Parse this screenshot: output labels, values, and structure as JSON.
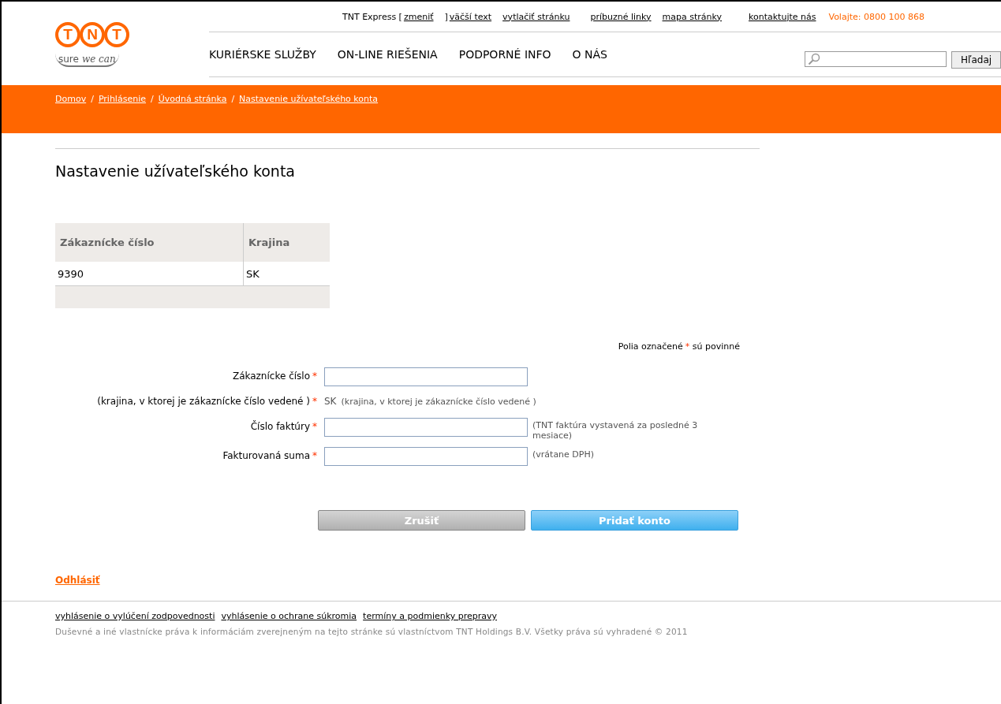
{
  "logo": {
    "letters": [
      "T",
      "N",
      "T"
    ],
    "tagline_plain": "sure",
    "tagline_script": "we can"
  },
  "top_links": [
    {
      "kind": "text",
      "text": "TNT Express ["
    },
    {
      "kind": "link",
      "text": "zmeniť"
    },
    {
      "kind": "text",
      "text": "]"
    },
    {
      "kind": "link",
      "text": "väčší text"
    },
    {
      "kind": "link",
      "text": "vytlačiť stránku"
    },
    {
      "kind": "link",
      "text": "príbuzné linky"
    },
    {
      "kind": "link",
      "text": "mapa stránky"
    },
    {
      "kind": "link",
      "text": "kontaktujte nás"
    },
    {
      "kind": "phone",
      "text": "Volajte: 0800 100 868"
    }
  ],
  "nav": [
    "KURIÉRSKE SLUŽBY",
    "ON-LINE RIEŠENIA",
    "PODPORNÉ INFO",
    "O NÁS"
  ],
  "search": {
    "button": "Hľadaj"
  },
  "breadcrumb": [
    "Domov",
    "Prihlásenie",
    "Úvodná stránka",
    "Nastavenie užívateľského konta"
  ],
  "breadcrumb_separator": "/",
  "page_title": "Nastavenie užívateľského konta",
  "table": {
    "columns": [
      "Zákaznícke číslo",
      "Krajina"
    ],
    "rows": [
      [
        "9390",
        "SK"
      ]
    ]
  },
  "required_note": {
    "before": "Polia označené",
    "mark": "*",
    "after": "sú povinné"
  },
  "form": [
    {
      "kind": "input",
      "label": "Zákaznícke číslo",
      "mark": "*"
    },
    {
      "kind": "static",
      "label": "(krajina, v ktorej je zákaznícke číslo vedené )",
      "mark": "*",
      "value": "SK",
      "hint": "(krajina, v ktorej je zákaznícke číslo vedené )"
    },
    {
      "kind": "input",
      "label": "Číslo faktúry",
      "mark": "*",
      "hint": "(TNT faktúra vystavená za posledné 3 mesiace)"
    },
    {
      "kind": "input",
      "label": "Fakturovaná suma",
      "mark": "*",
      "hint": "(vrátane DPH)"
    }
  ],
  "buttons": [
    {
      "kind": "cancel",
      "label": "Zrušiť"
    },
    {
      "kind": "primary",
      "label": "Pridať konto"
    }
  ],
  "logout": "Odhlásiť",
  "footer_links": [
    "vyhlásenie o vylúčení zodpovednosti",
    "vyhlásenie o ochrane súkromia",
    "termíny a podmienky prepravy"
  ],
  "copyright": "Duševné a iné vlastnícke práva k informáciám zverejneným na tejto stránke sú vlastníctvom TNT Holdings B.V. Všetky práva sú vyhradené © 2011"
}
